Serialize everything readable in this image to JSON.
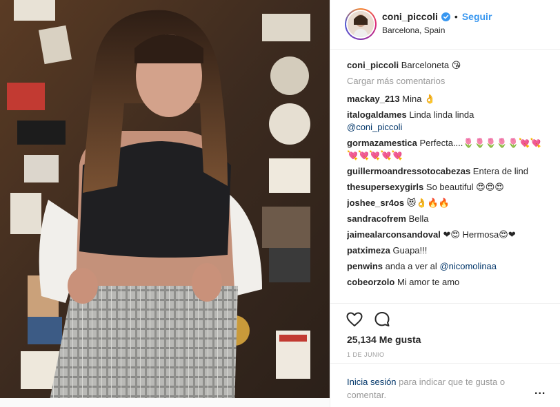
{
  "post": {
    "username": "coni_piccoli",
    "follow_label": "Seguir",
    "separator": "•",
    "location": "Barcelona, Spain",
    "caption_user": "coni_piccoli",
    "caption_text": "Barceloneta 😘",
    "load_more": "Cargar más comentarios",
    "likes": "25,134 Me gusta",
    "date": "1 DE JUNIO"
  },
  "comments": [
    {
      "user": "mackay_213",
      "text": "Mina 👌"
    },
    {
      "user": "italogaldames",
      "text": "Linda linda linda",
      "mention": "@coni_piccoli"
    },
    {
      "user": "gormazamestica",
      "text": "Perfecta....🌷🌷🌷🌷🌷💘💘💘💘💘💘💘"
    },
    {
      "user": "guillermoandressotocabezas",
      "text": "Entera de lind"
    },
    {
      "user": "thesupersexygirls",
      "text": "So beautiful 😍😍😍"
    },
    {
      "user": "joshee_sr4os",
      "text": "😻👌🔥🔥"
    },
    {
      "user": "sandracofrem",
      "text": "Bella"
    },
    {
      "user": "jaimealarconsandoval",
      "text": "❤😍 Hermosa😍❤"
    },
    {
      "user": "patximeza",
      "text": "Guapa!!!"
    },
    {
      "user": "penwins",
      "text": "anda a ver al",
      "mention": "@nicomolinaa"
    },
    {
      "user": "cobeorzolo",
      "text": "Mi amor te amo"
    }
  ],
  "login": {
    "link": "Inicia sesión",
    "rest": " para indicar que te gusta o comentar.",
    "more": "..."
  },
  "icons": {
    "like": "heart-icon",
    "comment": "comment-bubble-icon",
    "verified": "verified-badge-icon",
    "options": "more-options-icon"
  },
  "colors": {
    "link_blue": "#3897f0",
    "mention_blue": "#003569",
    "muted": "#999999",
    "text": "#262626",
    "border": "#efefef"
  }
}
